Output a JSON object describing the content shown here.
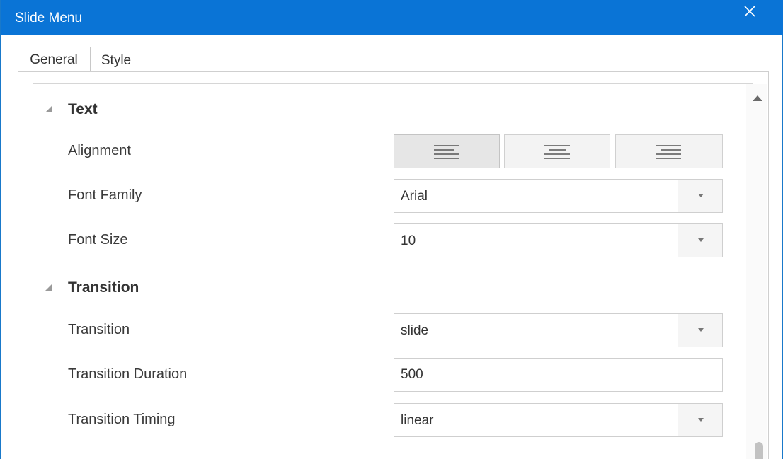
{
  "window": {
    "title": "Slide Menu"
  },
  "tabs": [
    {
      "label": "General",
      "active": false
    },
    {
      "label": "Style",
      "active": true
    }
  ],
  "sections": {
    "text": {
      "title": "Text",
      "alignment_label": "Alignment",
      "alignment_options": [
        "align-left",
        "align-center",
        "align-right"
      ],
      "alignment_selected": "align-left",
      "font_family_label": "Font Family",
      "font_family_value": "Arial",
      "font_size_label": "Font Size",
      "font_size_value": "10"
    },
    "transition": {
      "title": "Transition",
      "transition_label": "Transition",
      "transition_value": "slide",
      "duration_label": "Transition Duration",
      "duration_value": "500",
      "timing_label": "Transition Timing",
      "timing_value": "linear"
    }
  },
  "colors": {
    "titlebar": "#0a74d6",
    "title_text": "#ffffff",
    "panel_border": "#cfcfcf"
  }
}
